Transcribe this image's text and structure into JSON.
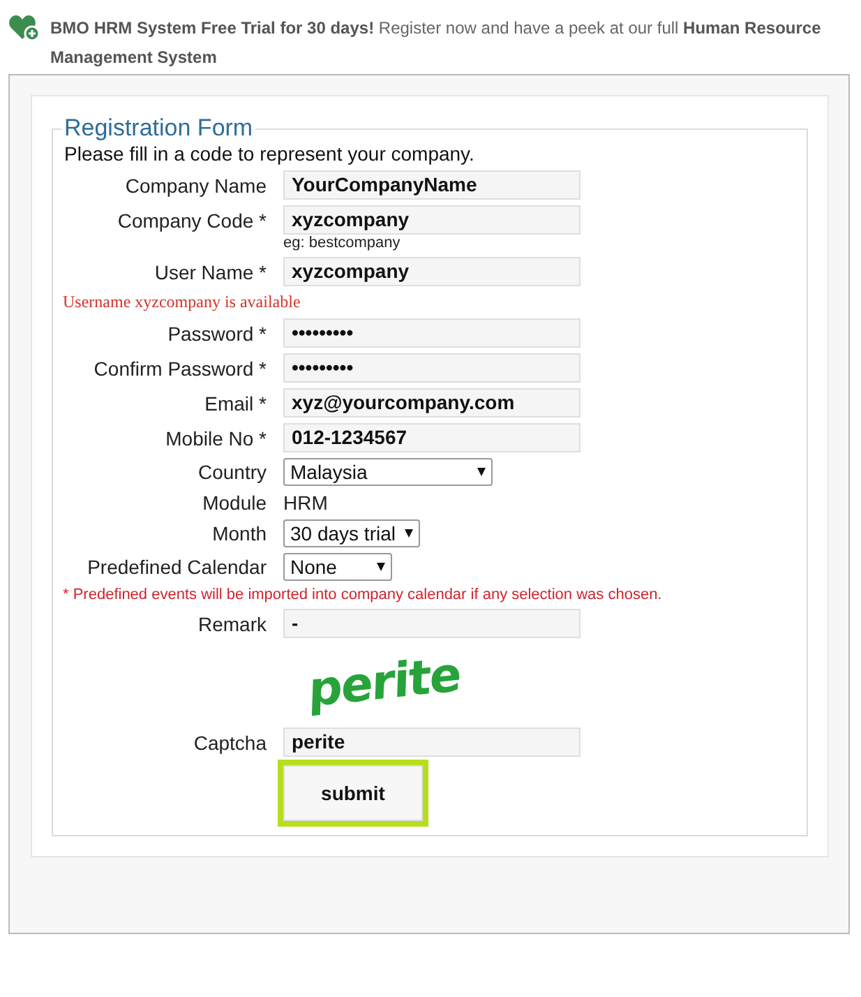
{
  "banner": {
    "text": "**BMO HRM System Free Trial for 30 days!** Register now and have a peek at our full **Human Resource Management System**"
  },
  "form": {
    "legend": "Registration Form",
    "intro": "Please fill in a code to represent your company.",
    "rows": [
      {
        "kind": "input",
        "label": "Company Name",
        "value": "YourCompanyName"
      },
      {
        "kind": "input",
        "label": "Company Code *",
        "value": "xyzcompany"
      },
      {
        "kind": "hint",
        "text": "eg: bestcompany"
      },
      {
        "kind": "input",
        "label": "User Name *",
        "value": "xyzcompany"
      },
      {
        "kind": "message",
        "text": "Username xyzcompany is available"
      },
      {
        "kind": "input",
        "label": "Password *",
        "value": "•••••••••"
      },
      {
        "kind": "input",
        "label": "Confirm Password *",
        "value": "•••••••••"
      },
      {
        "kind": "input",
        "label": "Email *",
        "value": "xyz@yourcompany.com"
      },
      {
        "kind": "input",
        "label": "Mobile No *",
        "value": "012-1234567"
      },
      {
        "kind": "select",
        "label": "Country",
        "value": "Malaysia"
      },
      {
        "kind": "static",
        "label": "Module",
        "value": "HRM"
      },
      {
        "kind": "select",
        "label": "Month",
        "value": "30 days trial"
      },
      {
        "kind": "select",
        "label": "Predefined Calendar",
        "value": "None"
      },
      {
        "kind": "note",
        "text": "* Predefined events will be imported into company calendar if any selection was chosen."
      },
      {
        "kind": "input",
        "label": "Remark",
        "value": "-"
      },
      {
        "kind": "captcha_image",
        "text": "perite"
      },
      {
        "kind": "input",
        "label": "Captcha",
        "value": "perite"
      }
    ],
    "submit": {
      "label": "submit",
      "highlighted": true
    }
  }
}
